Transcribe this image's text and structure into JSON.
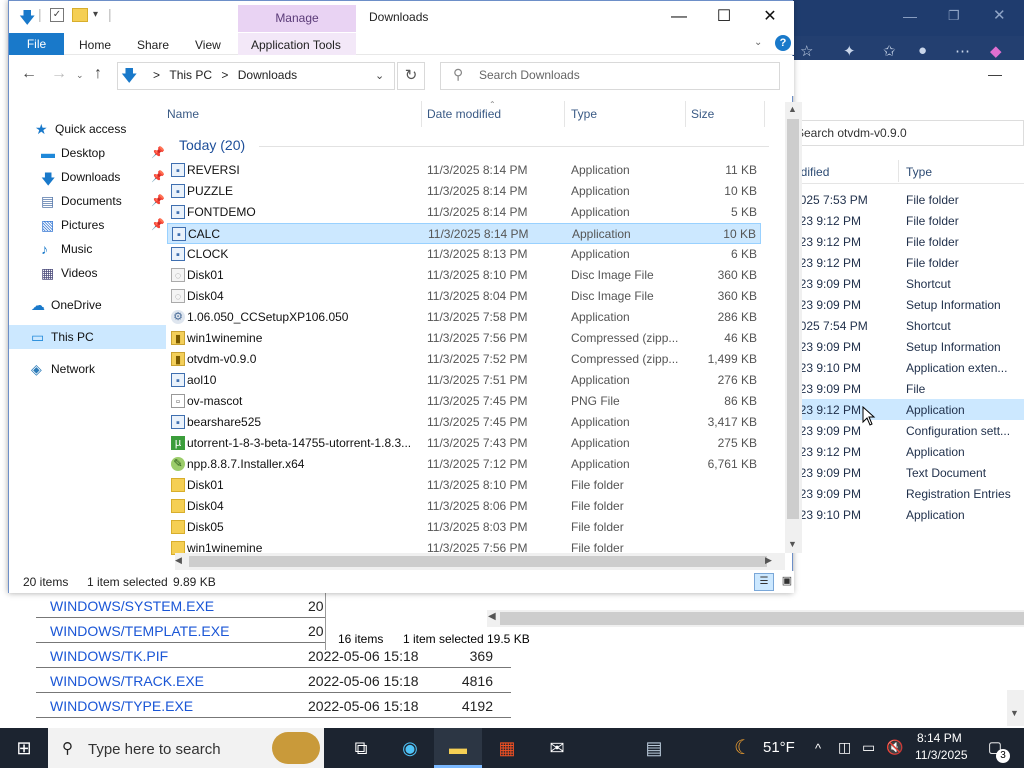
{
  "window": {
    "title": "Downloads",
    "manage_label": "Manage",
    "app_tools_label": "Application Tools",
    "minimize": "—",
    "maximize": "☐",
    "close": "✕"
  },
  "ribbon": {
    "file": "File",
    "home": "Home",
    "share": "Share",
    "view": "View",
    "help": "?"
  },
  "address": {
    "pc": "This PC",
    "folder": "Downloads",
    "separator": ">"
  },
  "search": {
    "placeholder": "Search Downloads"
  },
  "nav_pane": [
    {
      "label": "Quick access",
      "icon": "star-icon",
      "pinned": false
    },
    {
      "label": "Desktop",
      "icon": "desktop-icon",
      "pinned": true
    },
    {
      "label": "Downloads",
      "icon": "download-folder-icon",
      "pinned": true
    },
    {
      "label": "Documents",
      "icon": "documents-icon",
      "pinned": true
    },
    {
      "label": "Pictures",
      "icon": "pictures-icon",
      "pinned": true
    },
    {
      "label": "Music",
      "icon": "music-icon",
      "pinned": false
    },
    {
      "label": "Videos",
      "icon": "videos-icon",
      "pinned": false
    },
    {
      "label": "OneDrive",
      "icon": "onedrive-icon",
      "pinned": false
    },
    {
      "label": "This PC",
      "icon": "this-pc-icon",
      "pinned": false
    },
    {
      "label": "Network",
      "icon": "network-icon",
      "pinned": false
    }
  ],
  "columns": {
    "name": "Name",
    "date": "Date modified",
    "type": "Type",
    "size": "Size"
  },
  "group_label": "Today (20)",
  "files": [
    {
      "name": "REVERSI",
      "date": "11/3/2025 8:14 PM",
      "type": "Application",
      "size": "11 KB",
      "icon": "app"
    },
    {
      "name": "PUZZLE",
      "date": "11/3/2025 8:14 PM",
      "type": "Application",
      "size": "10 KB",
      "icon": "app"
    },
    {
      "name": "FONTDEMO",
      "date": "11/3/2025 8:14 PM",
      "type": "Application",
      "size": "5 KB",
      "icon": "app"
    },
    {
      "name": "CALC",
      "date": "11/3/2025 8:14 PM",
      "type": "Application",
      "size": "10 KB",
      "icon": "app"
    },
    {
      "name": "CLOCK",
      "date": "11/3/2025 8:13 PM",
      "type": "Application",
      "size": "6 KB",
      "icon": "app"
    },
    {
      "name": "Disk01",
      "date": "11/3/2025 8:10 PM",
      "type": "Disc Image File",
      "size": "360 KB",
      "icon": "disc"
    },
    {
      "name": "Disk04",
      "date": "11/3/2025 8:04 PM",
      "type": "Disc Image File",
      "size": "360 KB",
      "icon": "disc"
    },
    {
      "name": "1.06.050_CCSetupXP106.050",
      "date": "11/3/2025 7:58 PM",
      "type": "Application",
      "size": "286 KB",
      "icon": "set"
    },
    {
      "name": "win1winemine",
      "date": "11/3/2025 7:56 PM",
      "type": "Compressed (zipp...",
      "size": "46 KB",
      "icon": "zip"
    },
    {
      "name": "otvdm-v0.9.0",
      "date": "11/3/2025 7:52 PM",
      "type": "Compressed (zipp...",
      "size": "1,499 KB",
      "icon": "zip"
    },
    {
      "name": "aol10",
      "date": "11/3/2025 7:51 PM",
      "type": "Application",
      "size": "276 KB",
      "icon": "app"
    },
    {
      "name": "ov-mascot",
      "date": "11/3/2025 7:45 PM",
      "type": "PNG File",
      "size": "86 KB",
      "icon": "png"
    },
    {
      "name": "bearshare525",
      "date": "11/3/2025 7:45 PM",
      "type": "Application",
      "size": "3,417 KB",
      "icon": "app"
    },
    {
      "name": "utorrent-1-8-3-beta-14755-utorrent-1.8.3...",
      "date": "11/3/2025 7:43 PM",
      "type": "Application",
      "size": "275 KB",
      "icon": "ut"
    },
    {
      "name": "npp.8.8.7.Installer.x64",
      "date": "11/3/2025 7:12 PM",
      "type": "Application",
      "size": "6,761 KB",
      "icon": "npp"
    },
    {
      "name": "Disk01",
      "date": "11/3/2025 8:10 PM",
      "type": "File folder",
      "size": "",
      "icon": "folder"
    },
    {
      "name": "Disk04",
      "date": "11/3/2025 8:06 PM",
      "type": "File folder",
      "size": "",
      "icon": "folder"
    },
    {
      "name": "Disk05",
      "date": "11/3/2025 8:03 PM",
      "type": "File folder",
      "size": "",
      "icon": "folder"
    },
    {
      "name": "win1winemine",
      "date": "11/3/2025 7:56 PM",
      "type": "File folder",
      "size": "",
      "icon": "folder"
    }
  ],
  "selected_index": 3,
  "status": {
    "items": "20 items",
    "selected": "1 item selected",
    "size": "9.89 KB"
  },
  "explorer2": {
    "search_placeholder": "Search otvdm-v0.9.0",
    "col_date": "odified",
    "col_type": "Type",
    "rows": [
      {
        "date": "2025 7:53 PM",
        "type": "File folder"
      },
      {
        "date": "023 9:12 PM",
        "type": "File folder"
      },
      {
        "date": "023 9:12 PM",
        "type": "File folder"
      },
      {
        "date": "023 9:12 PM",
        "type": "File folder"
      },
      {
        "date": "023 9:09 PM",
        "type": "Shortcut"
      },
      {
        "date": "023 9:09 PM",
        "type": "Setup Information"
      },
      {
        "date": "2025 7:54 PM",
        "type": "Shortcut"
      },
      {
        "date": "023 9:09 PM",
        "type": "Setup Information"
      },
      {
        "date": "023 9:10 PM",
        "type": "Application exten..."
      },
      {
        "date": "023 9:09 PM",
        "type": "File"
      },
      {
        "date": "023 9:12 PM",
        "type": "Application"
      },
      {
        "date": "023 9:09 PM",
        "type": "Configuration sett..."
      },
      {
        "date": "023 9:12 PM",
        "type": "Application"
      },
      {
        "date": "023 9:09 PM",
        "type": "Text Document"
      },
      {
        "date": "023 9:09 PM",
        "type": "Registration Entries"
      },
      {
        "date": "023 9:10 PM",
        "type": "Application"
      }
    ],
    "selected_row": 10,
    "status_items": "16 items",
    "status_selected": "1 item selected",
    "status_size": "19.5 KB"
  },
  "web_list": [
    {
      "name": "WINDOWS/SYSTEM.EXE",
      "date": "20",
      "size": ""
    },
    {
      "name": "WINDOWS/TEMPLATE.EXE",
      "date": "20",
      "size": ""
    },
    {
      "name": "WINDOWS/TK.PIF",
      "date": "2022-05-06 15:18",
      "size": "369"
    },
    {
      "name": "WINDOWS/TRACK.EXE",
      "date": "2022-05-06 15:18",
      "size": "4816"
    },
    {
      "name": "WINDOWS/TYPE.EXE",
      "date": "2022-05-06 15:18",
      "size": "4192"
    }
  ],
  "taskbar": {
    "search_placeholder": "Type here to search",
    "temperature": "51°F",
    "time": "8:14 PM",
    "date": "11/3/2025",
    "notification_count": "3"
  }
}
